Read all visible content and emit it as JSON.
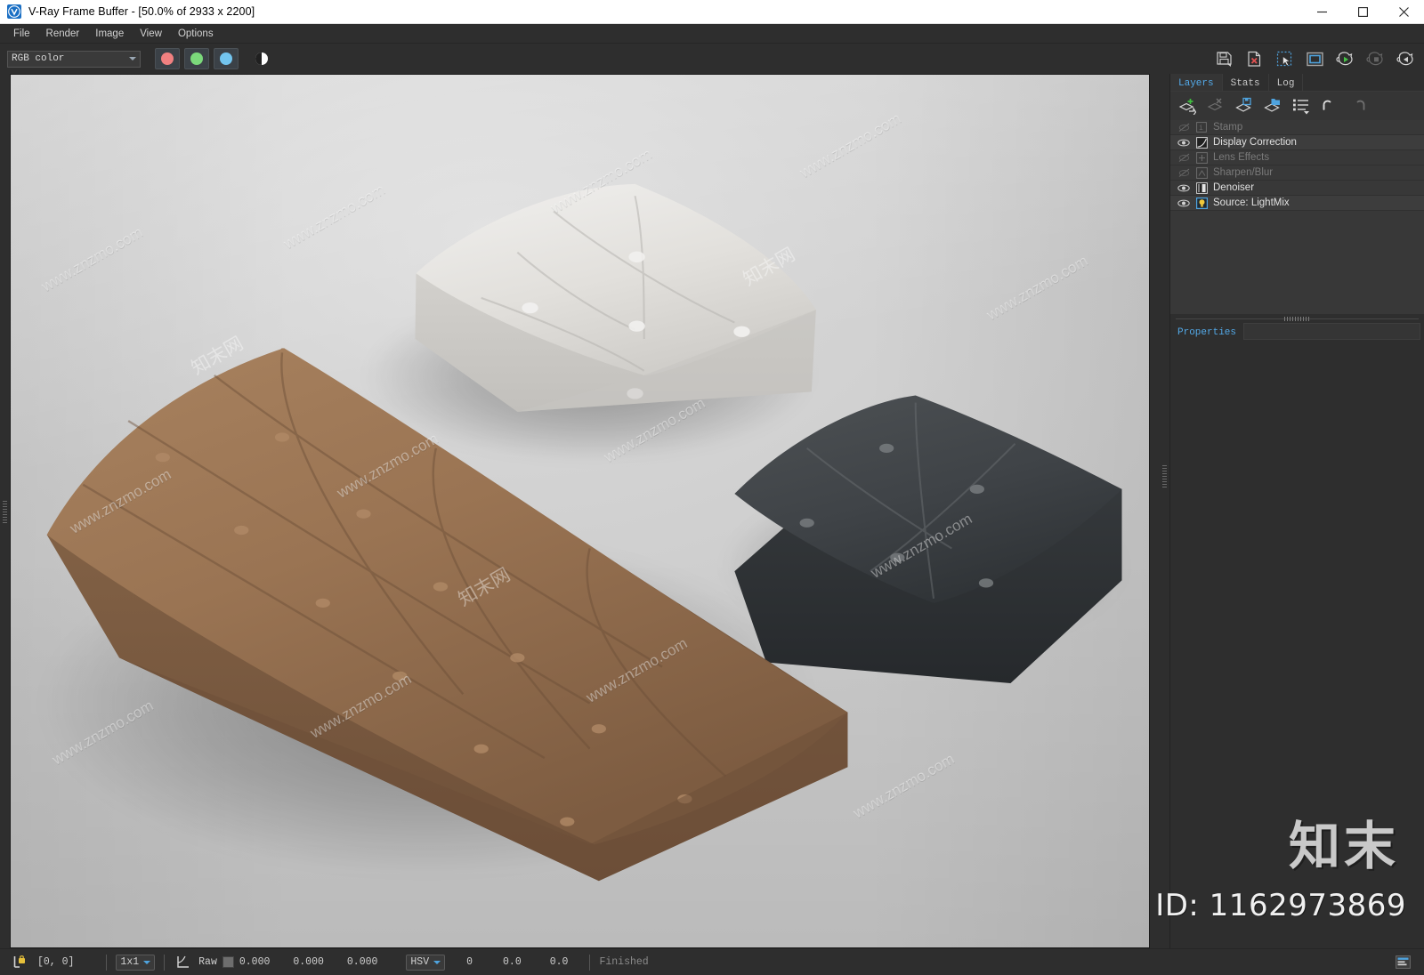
{
  "window": {
    "title": "V-Ray Frame Buffer - [50.0% of 2933 x 2200]",
    "app_icon": "vray-logo-icon",
    "minimize_label": "—",
    "maximize_label": "□",
    "close_label": "✕"
  },
  "menubar": {
    "items": [
      {
        "label": "File",
        "name": "menu-file"
      },
      {
        "label": "Render",
        "name": "menu-render"
      },
      {
        "label": "Image",
        "name": "menu-image"
      },
      {
        "label": "View",
        "name": "menu-view"
      },
      {
        "label": "Options",
        "name": "menu-options"
      }
    ]
  },
  "toolbar": {
    "channel_select": {
      "value": "RGB color",
      "placeholder": "RGB color"
    },
    "channel_buttons": [
      {
        "name": "red-channel-button",
        "color": "#f08080"
      },
      {
        "name": "green-channel-button",
        "color": "#7bd97b"
      },
      {
        "name": "blue-channel-button",
        "color": "#73c5ef"
      }
    ],
    "alpha_button": {
      "name": "alpha-channel-button"
    },
    "right_icons": [
      {
        "name": "save-image-icon",
        "title": "Save current channel"
      },
      {
        "name": "clear-image-icon",
        "title": "Clear image"
      },
      {
        "name": "region-render-icon",
        "title": "Track mouse while rendering"
      },
      {
        "name": "show-vfb-icon",
        "title": "Show last VFB"
      },
      {
        "name": "render-start-icon",
        "title": "Render last"
      },
      {
        "name": "render-stop-icon",
        "title": "Stop render"
      },
      {
        "name": "render-previous-icon",
        "title": "Render previous"
      }
    ]
  },
  "dock": {
    "tabs": [
      {
        "label": "Layers",
        "name": "tab-layers",
        "active": true
      },
      {
        "label": "Stats",
        "name": "tab-stats",
        "active": false
      },
      {
        "label": "Log",
        "name": "tab-log",
        "active": false
      }
    ],
    "layer_toolbar": [
      {
        "name": "add-layer-icon"
      },
      {
        "name": "delete-layer-icon"
      },
      {
        "name": "save-layers-icon"
      },
      {
        "name": "load-layers-icon"
      },
      {
        "name": "layer-presets-icon"
      },
      {
        "name": "undo-icon"
      },
      {
        "name": "redo-icon"
      }
    ],
    "layers": [
      {
        "label": "Stamp",
        "name": "layer-stamp",
        "visible": false,
        "enabled": false,
        "icon": "stamp-icon"
      },
      {
        "label": "Display Correction",
        "name": "layer-display-correction",
        "visible": true,
        "enabled": true,
        "icon": "curve-icon"
      },
      {
        "label": "Lens Effects",
        "name": "layer-lens-effects",
        "visible": false,
        "enabled": false,
        "icon": "lens-icon"
      },
      {
        "label": "Sharpen/Blur",
        "name": "layer-sharpen-blur",
        "visible": false,
        "enabled": false,
        "icon": "sharpen-icon"
      },
      {
        "label": "Denoiser",
        "name": "layer-denoiser",
        "visible": true,
        "enabled": true,
        "icon": "denoiser-icon"
      },
      {
        "label": "Source: LightMix",
        "name": "layer-source-lightmix",
        "visible": true,
        "enabled": true,
        "icon": "lightmix-icon"
      }
    ],
    "properties": {
      "title": "Properties"
    }
  },
  "statusbar": {
    "pixel_lock_icon": "pixel-lock-icon",
    "coords": "[0,  0]",
    "zoom_combo": "1x1",
    "corner_icon": "corner-origin-icon",
    "raw_label": "Raw",
    "color_swatch": "#6e6e6e",
    "rgb": [
      "0.000",
      "0.000",
      "0.000"
    ],
    "color_mode": "HSV",
    "hsv": [
      "0",
      "0.0",
      "0.0"
    ],
    "render_status": "Finished",
    "settings_icon": "vfb-settings-icon"
  },
  "watermark": {
    "brand": "知末",
    "id": "ID: 1162973869",
    "tile_text": "www.znzmo.com",
    "tile_cn": "知末网"
  },
  "render_image": {
    "description": "3D render of three tufted floor cushions on a light grey backdrop",
    "objects": [
      {
        "name": "long-brown-cushion",
        "color": "#9b7454"
      },
      {
        "name": "white-square-cushion",
        "color": "#e4e2df"
      },
      {
        "name": "dark-grey-square-cushion",
        "color": "#3f4245"
      }
    ],
    "background_color": "#d2d2d2"
  }
}
